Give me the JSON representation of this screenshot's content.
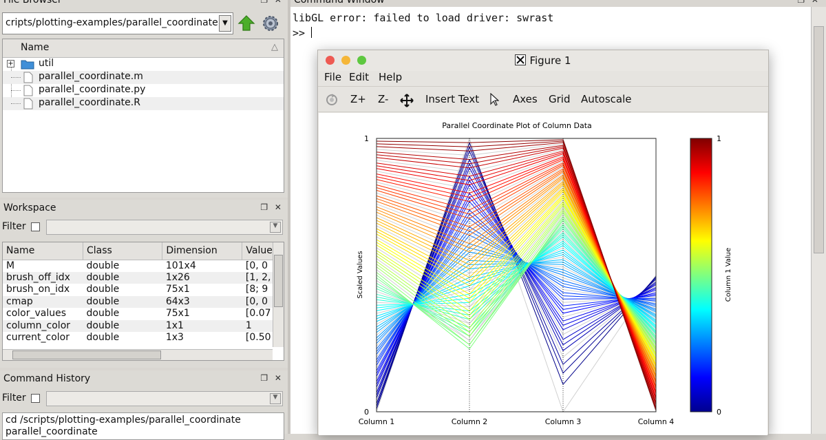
{
  "file_browser": {
    "title": "File Browser",
    "dock_buttons": "❐ ✕",
    "path": "cripts/plotting-examples/parallel_coordinate",
    "column_name": "Name",
    "items": [
      {
        "label": "util",
        "type": "folder"
      },
      {
        "label": "parallel_coordinate.m",
        "type": "file"
      },
      {
        "label": "parallel_coordinate.py",
        "type": "file"
      },
      {
        "label": "parallel_coordinate.R",
        "type": "file"
      }
    ]
  },
  "workspace": {
    "title": "Workspace",
    "dock_buttons": "❐ ✕",
    "filter_label": "Filter",
    "columns": [
      "Name",
      "Class",
      "Dimension",
      "Value"
    ],
    "rows": [
      [
        "M",
        "double",
        "101x4",
        "[0, 0"
      ],
      [
        "brush_off_idx",
        "double",
        "1x26",
        "[1, 2,"
      ],
      [
        "brush_on_idx",
        "double",
        "75x1",
        "[8; 9"
      ],
      [
        "cmap",
        "double",
        "64x3",
        "[0, 0"
      ],
      [
        "color_values",
        "double",
        "75x1",
        "[0.07"
      ],
      [
        "column_color",
        "double",
        "1x1",
        "1"
      ],
      [
        "current_color",
        "double",
        "1x3",
        "[0.50"
      ]
    ]
  },
  "command_history": {
    "title": "Command History",
    "dock_buttons": "❐ ✕",
    "filter_label": "Filter",
    "entries": [
      "cd /scripts/plotting-examples/parallel_coordinate",
      "parallel_coordinate"
    ]
  },
  "command_window": {
    "title": "Command Window",
    "dock_buttons": "❐ ✕",
    "lines": [
      "libGL error: failed to load driver: swrast",
      ">> "
    ]
  },
  "figure": {
    "window_title": "Figure 1",
    "menu": [
      "File",
      "Edit",
      "Help"
    ],
    "toolbar": [
      "Z+",
      "Z-",
      "Insert Text",
      "Axes",
      "Grid",
      "Autoscale"
    ],
    "colors": {
      "close": "#ee5a52",
      "minimize": "#f5b638",
      "maximize": "#5ec840"
    }
  },
  "chart_data": {
    "type": "line",
    "title": "Parallel Coordinate Plot of Column Data",
    "ylabel": "Scaled Values",
    "colorbar_label": "Column 1 Value",
    "colorbar_ticks": [
      "0",
      "1"
    ],
    "ylim": [
      0,
      1
    ],
    "y_ticks": [
      "0",
      "1"
    ],
    "categories": [
      "Column 1",
      "Column 2",
      "Column 3",
      "Column 4"
    ],
    "n_lines": 101,
    "highlighted_lines": 75,
    "grey_lines": 26,
    "colormap": "jet",
    "grey_color": "#d0d0d0"
  }
}
